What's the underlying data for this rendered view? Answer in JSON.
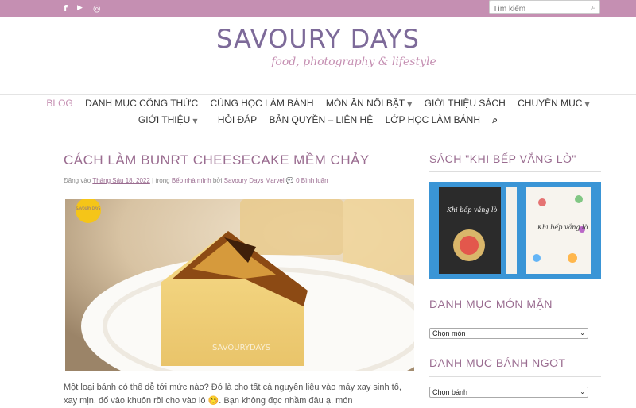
{
  "topbar": {
    "social": [
      "f",
      "▶",
      "◎"
    ],
    "search_placeholder": "Tìm kiếm"
  },
  "header": {
    "site_title": "SAVOURY DAYS",
    "tagline": "food, photography & lifestyle"
  },
  "nav": {
    "row1": [
      "BLOG",
      "DANH MỤC CÔNG THỨC",
      "CÙNG HỌC LÀM BÁNH",
      "MÓN ĂN NỔI BẬT",
      "GIỚI THIỆU SÁCH",
      "CHUYÊN MỤC"
    ],
    "row2": [
      "GIỚI THIỆU",
      "HỎI ĐÁP",
      "BẢN QUYỀN – LIÊN HỆ",
      "LỚP HỌC LÀM BÁNH"
    ]
  },
  "post": {
    "title": "CÁCH LÀM BUNRT CHEESECAKE MỀM CHẢY",
    "meta_prefix": "Đăng vào",
    "meta_date": "Tháng Sáu 18, 2022",
    "meta_sep": "| trong",
    "meta_category": "Bếp nhà mình",
    "meta_by": "bởi",
    "meta_author": "Savoury Days Marvel",
    "meta_comments": "0 Bình luận",
    "image_badge": "SAVOURY DAYS",
    "image_watermark": "SAVOURYDAYS",
    "body": "Một loại bánh có thể dễ tới mức nào? Đó là cho tất cả nguyên liệu vào máy xay sinh tố, xay mịn, đổ vào khuôn rồi cho vào lò 😊. Bạn không đọc nhầm đâu ạ, món"
  },
  "sidebar": {
    "book_title": "SÁCH \"KHI BẾP VẮNG LÒ\"",
    "book_cover_left": "Khi bếp vắng lò",
    "book_cover_right": "Khi bếp vắng lò",
    "savory_title": "DANH MỤC MÓN MẶN",
    "savory_select": "Chọn món",
    "sweet_title": "DANH MỤC BÁNH NGỌT",
    "sweet_select": "Chọn bánh"
  },
  "colors": {
    "accent": "#c58fb2",
    "title_purple": "#7d6a99",
    "heading_mauve": "#9a6c90"
  }
}
